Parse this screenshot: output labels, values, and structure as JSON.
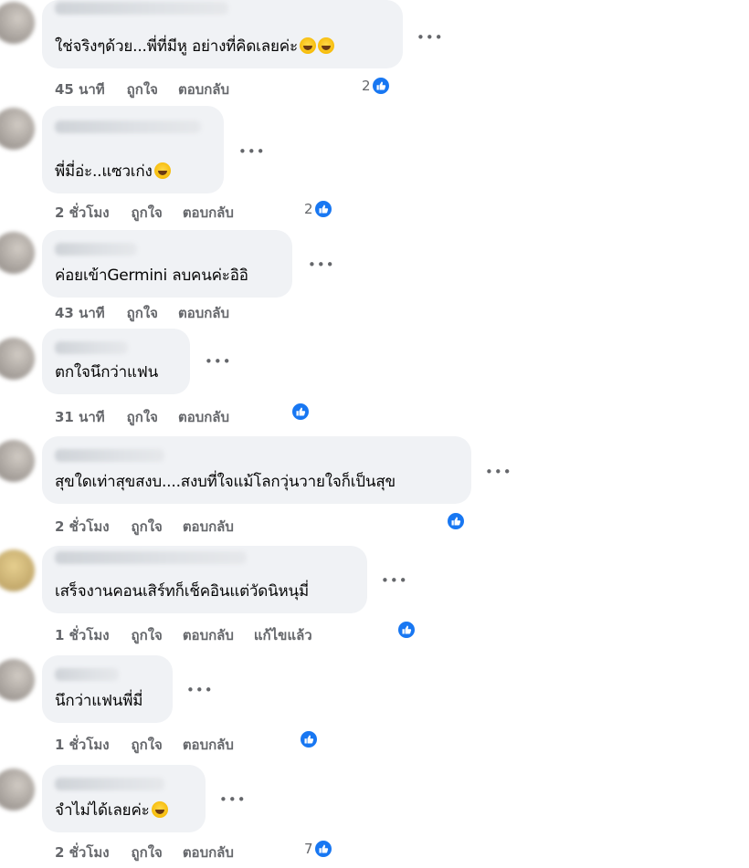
{
  "comments": [
    {
      "text": "ใช่จริงๆด้วย...พี่ที่มีหู อย่างที่คิดเลยค่ะ",
      "emoji": [
        "rofl",
        "rofl"
      ],
      "time": "45 นาที",
      "like": "ถูกใจ",
      "reply": "ตอบกลับ",
      "edited": "",
      "reactions": "2"
    },
    {
      "text": "พี่มี่อ่ะ..แซวเก่ง",
      "emoji": [
        "grin-sweat"
      ],
      "time": "2 ชั่วโมง",
      "like": "ถูกใจ",
      "reply": "ตอบกลับ",
      "edited": "",
      "reactions": "2"
    },
    {
      "text": "ค่อยเข้าGermini ลบคนค่ะอิอิ",
      "emoji": [],
      "time": "43 นาที",
      "like": "ถูกใจ",
      "reply": "ตอบกลับ",
      "edited": "",
      "reactions": ""
    },
    {
      "text": "ตกใจนึกว่าแฟน",
      "emoji": [],
      "time": "31 นาที",
      "like": "ถูกใจ",
      "reply": "ตอบกลับ",
      "edited": "",
      "reactions": ""
    },
    {
      "text": "สุขใดเท่าสุขสงบ....สงบที่ใจแม้โลกวุ่นวายใจก็เป็นสุข",
      "emoji": [],
      "time": "2 ชั่วโมง",
      "like": "ถูกใจ",
      "reply": "ตอบกลับ",
      "edited": "",
      "reactions": ""
    },
    {
      "text": "เสร็จงานคอนเสิร์ทก็เช็คอินแต่วัดนิหนุมี่",
      "emoji": [],
      "time": "1 ชั่วโมง",
      "like": "ถูกใจ",
      "reply": "ตอบกลับ",
      "edited": "แก้ไขแล้ว",
      "reactions": ""
    },
    {
      "text": "นึกว่าแฟนพี่มี่",
      "emoji": [],
      "time": "1 ชั่วโมง",
      "like": "ถูกใจ",
      "reply": "ตอบกลับ",
      "edited": "",
      "reactions": ""
    },
    {
      "text": "จำไม่ได้เลยค่ะ",
      "emoji": [
        "grin"
      ],
      "time": "2 ชั่วโมง",
      "like": "ถูกใจ",
      "reply": "ตอบกลับ",
      "edited": "",
      "reactions": "7"
    }
  ],
  "more_icon": "•••",
  "icons": {
    "like": "thumbs-up-icon",
    "more": "more-horizontal-icon"
  },
  "colors": {
    "like_blue": "#1877f2",
    "bubble": "#f0f2f5",
    "meta": "#65676b"
  }
}
